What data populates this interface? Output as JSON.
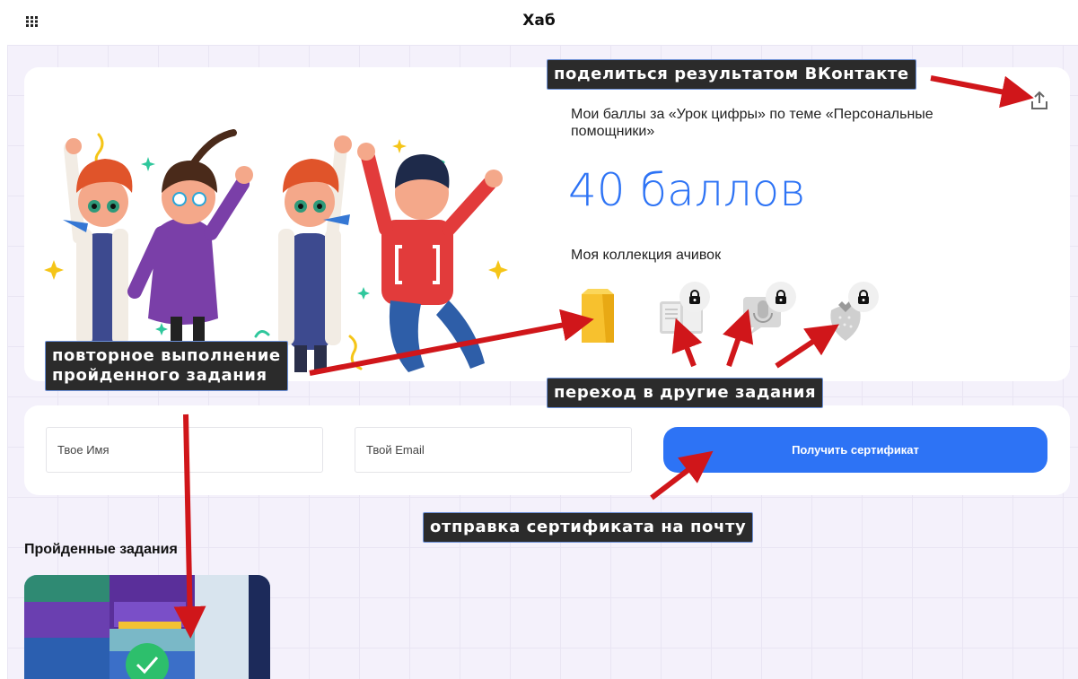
{
  "header": {
    "title": "Хаб"
  },
  "result": {
    "caption": "Мои баллы за «Урок цифры» по теме «Персональные помощники»",
    "score": "40 баллов",
    "collection_title": "Моя коллекция ачивок",
    "badges": [
      {
        "icon": "box-badge-icon",
        "locked": false
      },
      {
        "icon": "book-badge-icon",
        "locked": true
      },
      {
        "icon": "microphone-badge-icon",
        "locked": true
      },
      {
        "icon": "strawberry-badge-icon",
        "locked": true
      }
    ]
  },
  "form": {
    "name_placeholder": "Твое Имя",
    "email_placeholder": "Твой Email",
    "submit_label": "Получить сертификат"
  },
  "completed": {
    "title": "Пройденные задания"
  },
  "annotations": {
    "share": "поделиться результатом ВКонтакте",
    "repeat_line1": "повторное выполнение",
    "repeat_line2": "пройденного задания",
    "other_tasks": "переход в другие задания",
    "send_cert": "отправка сертификата на почту"
  },
  "colors": {
    "accent": "#2d73f5",
    "page_bg": "#f4f1fb",
    "annotation_bg": "#2b2b2b",
    "arrow": "#d0161a"
  }
}
